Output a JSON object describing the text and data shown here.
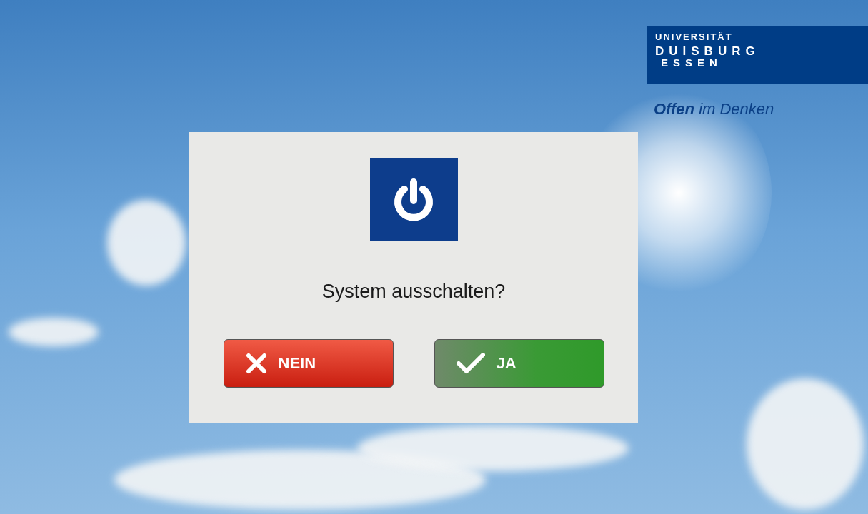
{
  "logo": {
    "university": "UNIVERSITÄT",
    "city_1": "DUISBURG",
    "city_2": "ESSEN",
    "tagline": "**Offen** im Denken"
  },
  "dialog": {
    "question": "System ausschalten?",
    "buttons": [
      {
        "kind": "cancel",
        "label": "NEIN"
      },
      {
        "kind": "confirm",
        "label": "JA"
      }
    ]
  }
}
